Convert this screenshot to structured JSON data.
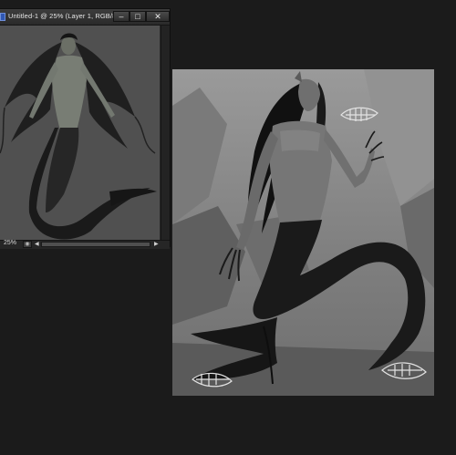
{
  "document_window": {
    "title": "Untitled-1 @ 25% (Layer 1, RGB/8) *",
    "zoom": "25%",
    "buttons": {
      "minimize_icon": "minimize-icon",
      "maximize_icon": "maximize-icon",
      "close_icon": "close-icon"
    }
  },
  "colors": {
    "workspace": "#1b1b1b",
    "doc_canvas": "#4d4d4d",
    "painting_background": "#8a8a8a",
    "tail": "#1a1a1a"
  },
  "images": {
    "small_preview": "mermaid-sketch-thumbnail",
    "large_painting": "grayscale-merman-painting"
  }
}
